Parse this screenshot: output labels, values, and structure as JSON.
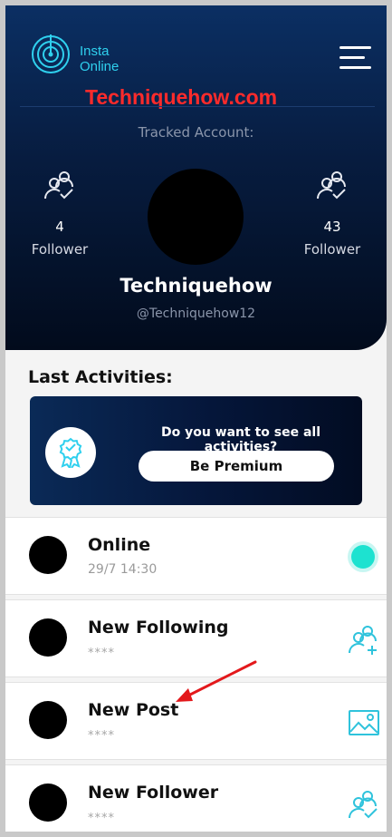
{
  "app": {
    "name_line1": "Insta",
    "name_line2": "Online"
  },
  "watermark": "Techniquehow.com",
  "tracked_label": "Tracked Account:",
  "stats": {
    "left": {
      "value": "4",
      "label": "Follower"
    },
    "right": {
      "value": "43",
      "label": "Follower"
    }
  },
  "profile": {
    "name": "Techniquehow",
    "handle": "@Techniquehow12"
  },
  "activities": {
    "title": "Last Activities:",
    "premium_question": "Do you want to see all activities?",
    "premium_button": "Be Premium",
    "items": [
      {
        "title": "Online",
        "subtitle": "29/7 14:30",
        "icon": "online-status-dot"
      },
      {
        "title": "New Following",
        "subtitle": "****",
        "icon": "user-add-icon"
      },
      {
        "title": "New Post",
        "subtitle": "****",
        "icon": "image-icon"
      },
      {
        "title": "New Follower",
        "subtitle": "****",
        "icon": "user-check-icon"
      }
    ]
  },
  "colors": {
    "header_top": "#0b2f63",
    "header_bottom": "#020b1c",
    "accent_cyan": "#2fd0ee",
    "online_green": "#1de2d0",
    "watermark_red": "#ff2b2b",
    "annotation_arrow": "#e3181b"
  }
}
